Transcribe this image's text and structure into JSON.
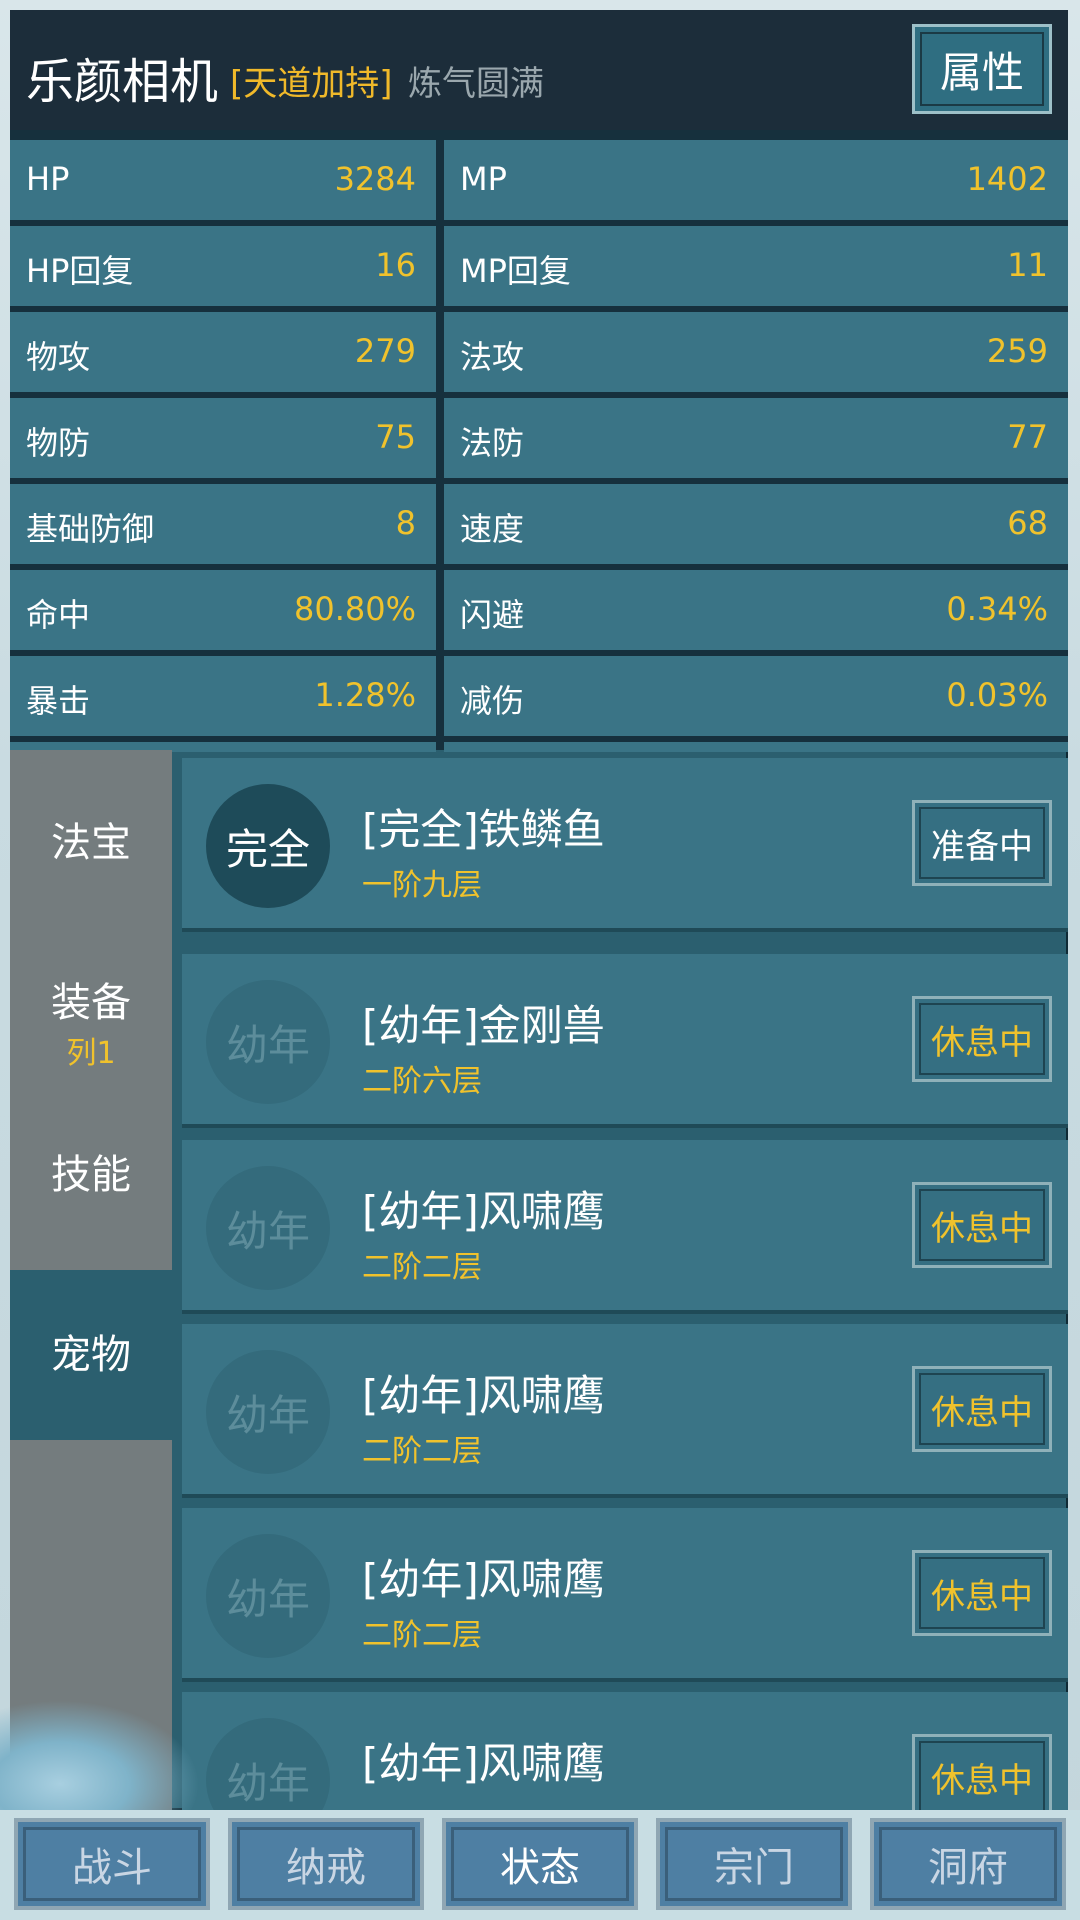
{
  "header": {
    "name": "乐颜相机",
    "blessing": "[天道加持]",
    "realm": "炼气圆满",
    "attributes_button": "属性"
  },
  "stats": {
    "left": [
      {
        "label": "HP",
        "value": "3284"
      },
      {
        "label": "HP回复",
        "value": "16"
      },
      {
        "label": "物攻",
        "value": "279"
      },
      {
        "label": "物防",
        "value": "75"
      },
      {
        "label": "基础防御",
        "value": "8"
      },
      {
        "label": "命中",
        "value": "80.80%"
      },
      {
        "label": "暴击",
        "value": "1.28%"
      }
    ],
    "right": [
      {
        "label": "MP",
        "value": "1402"
      },
      {
        "label": "MP回复",
        "value": "11"
      },
      {
        "label": "法攻",
        "value": "259"
      },
      {
        "label": "法防",
        "value": "77"
      },
      {
        "label": "速度",
        "value": "68"
      },
      {
        "label": "闪避",
        "value": "0.34%"
      },
      {
        "label": "减伤",
        "value": "0.03%"
      }
    ]
  },
  "sidebar": {
    "tabs": [
      {
        "label": "法宝",
        "badge": ""
      },
      {
        "label": "装备",
        "badge": "列1"
      },
      {
        "label": "技能",
        "badge": ""
      },
      {
        "label": "宠物",
        "badge": ""
      }
    ],
    "active": "宠物"
  },
  "pets": [
    {
      "circle": "完全",
      "name": "[完全]铁鳞鱼",
      "tier": "一阶九层",
      "status": "准备中"
    },
    {
      "circle": "幼年",
      "name": "[幼年]金刚兽",
      "tier": "二阶六层",
      "status": "休息中"
    },
    {
      "circle": "幼年",
      "name": "[幼年]风啸鹰",
      "tier": "二阶二层",
      "status": "休息中"
    },
    {
      "circle": "幼年",
      "name": "[幼年]风啸鹰",
      "tier": "二阶二层",
      "status": "休息中"
    },
    {
      "circle": "幼年",
      "name": "[幼年]风啸鹰",
      "tier": "二阶二层",
      "status": "休息中"
    },
    {
      "circle": "幼年",
      "name": "[幼年]风啸鹰",
      "tier": "",
      "status": "休息中"
    }
  ],
  "nav": {
    "items": [
      "战斗",
      "纳戒",
      "状态",
      "宗门",
      "洞府"
    ],
    "active": "状态"
  }
}
